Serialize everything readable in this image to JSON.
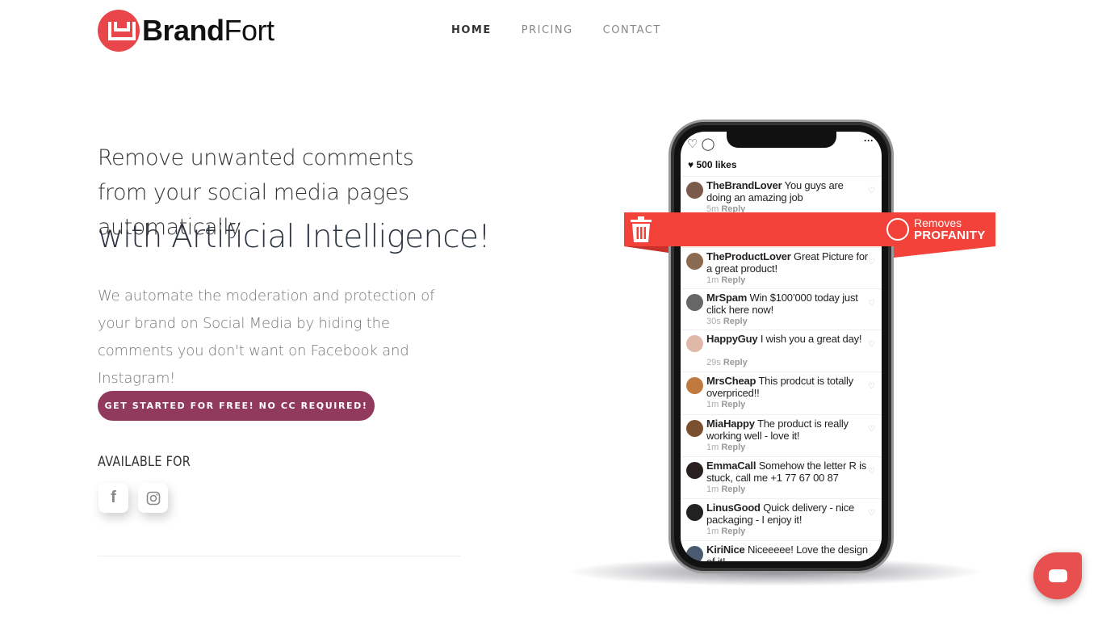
{
  "brand": {
    "name_bold": "Brand",
    "name_light": "Fort",
    "color": "#e8464a"
  },
  "nav": [
    {
      "label": "HOME",
      "active": true
    },
    {
      "label": "PRICING"
    },
    {
      "label": "CONTACT"
    }
  ],
  "hero": {
    "headline": "Remove unwanted comments from your social media pages automatically",
    "headline_emphasis": "with Artificial Intelligence!",
    "description": "We automate the moderation and protection of your brand on Social Media by hiding the comments you don't want on Facebook and Instagram!",
    "cta_label": "GET STARTED FOR FREE! NO CC REQUIRED!",
    "cta_color": "#923a5d",
    "available_label": "AVAILABLE FOR",
    "platforms": [
      {
        "name": "Facebook",
        "icon": "facebook-icon",
        "glyph": "f"
      },
      {
        "name": "Instagram",
        "icon": "instagram-icon"
      }
    ]
  },
  "phone": {
    "likes": "500 likes",
    "banner": {
      "line1": "Removes",
      "line2": "PROFANITY",
      "color": "#f2423a"
    },
    "comments": [
      {
        "user": "TheBrandLover",
        "text": "You guys are doing an amazing job",
        "time": "5m",
        "reply": "Reply",
        "avatar": "#7a5a4a"
      },
      {
        "user": "TheProductLover",
        "text": "Great Picture for a great product!",
        "time": "1m",
        "reply": "Reply",
        "avatar": "#8a6a50"
      },
      {
        "user": "MrSpam",
        "text": "Win $100’000 today just click here now!",
        "time": "30s",
        "reply": "Reply",
        "avatar": "#666"
      },
      {
        "user": "HappyGuy",
        "text": "I wish you a great day!",
        "time": "29s",
        "reply": "Reply",
        "avatar": "#e0b8a8"
      },
      {
        "user": "MrsCheap",
        "text": "This prodcut is totally overpriced!!",
        "time": "1m",
        "reply": "Reply",
        "avatar": "#c07a40"
      },
      {
        "user": "MiaHappy",
        "text": "The product is really working well - love it!",
        "time": "1m",
        "reply": "Reply",
        "avatar": "#7a5030"
      },
      {
        "user": "EmmaCall",
        "text": "Somehow the letter R is stuck, call me +1 77 67 00 87",
        "time": "1m",
        "reply": "Reply",
        "avatar": "#2a2020"
      },
      {
        "user": "LinusGood",
        "text": "Quick delivery - nice packaging - I enjoy it!",
        "time": "1m",
        "reply": "Reply",
        "avatar": "#222"
      },
      {
        "user": "KiriNice",
        "text": "Niceeeee! Love the design of it!",
        "time": "",
        "reply": "",
        "avatar": "#4a5a70"
      }
    ]
  },
  "chat_widget": {
    "icon": "chat-icon",
    "color": "#e8504f"
  }
}
